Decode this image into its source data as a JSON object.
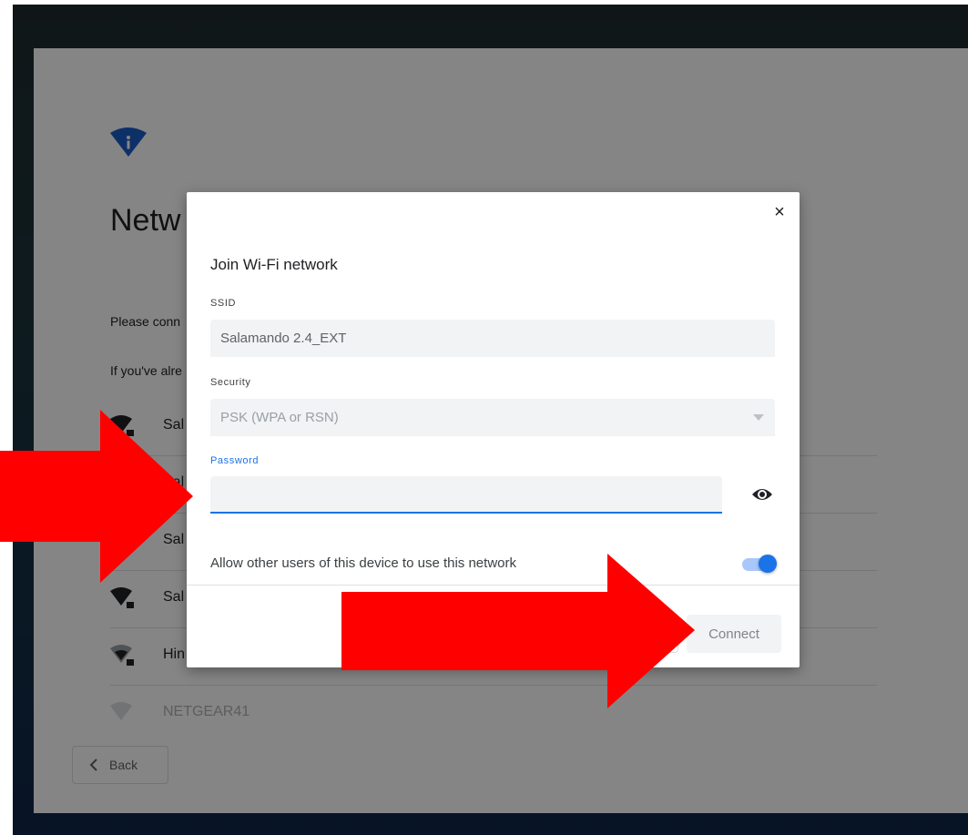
{
  "background_card": {
    "title": "Netw",
    "line1": "Please conn",
    "line2": "If you've alre",
    "networks": [
      {
        "name": "Sal",
        "icon": "wifi-locked-icon"
      },
      {
        "name": "Sal",
        "icon": "wifi-locked-icon"
      },
      {
        "name": "Sal",
        "icon": "wifi-locked-icon"
      },
      {
        "name": "Sal",
        "icon": "wifi-locked-icon"
      },
      {
        "name": "Hin",
        "icon": "wifi-locked-icon"
      },
      {
        "name": "NETGEAR41",
        "icon": "wifi-icon"
      }
    ],
    "back_label": "Back"
  },
  "dialog": {
    "title": "Join Wi-Fi network",
    "close_icon": "×",
    "ssid_label": "SSID",
    "ssid_value": "Salamando 2.4_EXT",
    "security_label": "Security",
    "security_value": "PSK (WPA or RSN)",
    "password_label": "Password",
    "password_value": "",
    "share_label": "Allow other users of this device to use this network",
    "share_enabled": true,
    "cancel_label": "",
    "connect_label": "Connect"
  },
  "colors": {
    "accent": "#1a73e8",
    "annotation_arrow": "#ff0000"
  }
}
